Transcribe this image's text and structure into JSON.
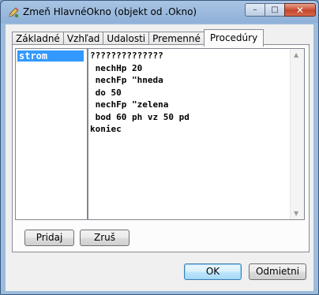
{
  "window": {
    "title": "Zmeň HlavnéOkno (objekt od .Okno)",
    "controls": {
      "minimize": "–",
      "maximize": "□",
      "close": "✕"
    }
  },
  "tabs": [
    {
      "label": "Základné",
      "active": false
    },
    {
      "label": "Vzhľad",
      "active": false
    },
    {
      "label": "Udalosti",
      "active": false
    },
    {
      "label": "Premenné",
      "active": false
    },
    {
      "label": "Procedúry",
      "active": true
    }
  ],
  "procedures": {
    "items": [
      "strom"
    ],
    "selected": "strom"
  },
  "editor": {
    "lines": [
      "??????????????",
      " nechHp 20",
      " nechFp \"hneda",
      " do 50",
      " nechFp \"zelena",
      " bod 60 ph vz 50 pd",
      "koniec"
    ]
  },
  "buttons": {
    "add": "Pridaj",
    "remove": "Zruš",
    "ok": "OK",
    "cancel": "Odmietni"
  },
  "icons": {
    "app": "pencil-icon",
    "scroll_up": "up-arrow-icon",
    "scroll_down": "down-arrow-icon"
  },
  "colors": {
    "selection": "#3399ff",
    "title_bar": "#a9c4e3",
    "close_button": "#c6472c"
  }
}
